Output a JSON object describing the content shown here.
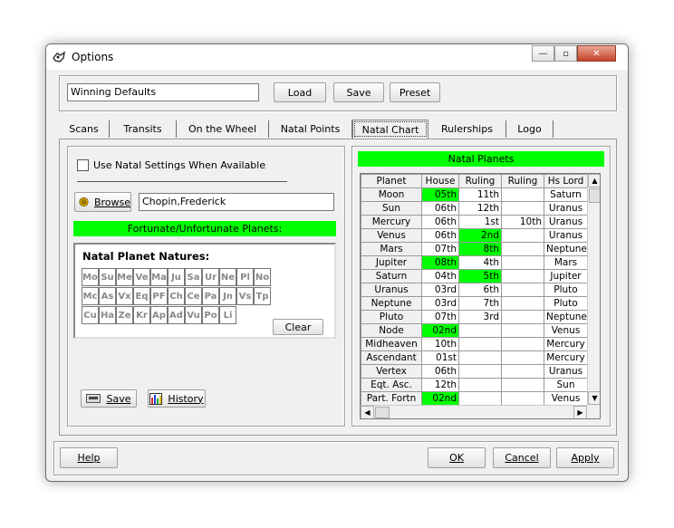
{
  "window": {
    "title": "Options",
    "minimize": "—",
    "restore": "▫",
    "close": "✕"
  },
  "preset": {
    "name_value": "Winning Defaults",
    "load_label": "Load",
    "save_label": "Save",
    "preset_label": "Preset"
  },
  "tabs": [
    {
      "label": "Scans"
    },
    {
      "label": "Transits"
    },
    {
      "label": "On the Wheel"
    },
    {
      "label": "Natal Points"
    },
    {
      "label": "Natal Chart"
    },
    {
      "label": "Rulerships"
    },
    {
      "label": "Logo"
    }
  ],
  "left": {
    "checkbox_label": "Use Natal Settings When Available",
    "browse_label": "Browse",
    "chart_name": "Chopin,Frederick",
    "fortunate_bar": "Fortunate/Unfortunate Planets:",
    "natures_title": "Natal Planet Natures:",
    "planets_row1": [
      "Mo",
      "Su",
      "Me",
      "Ve",
      "Ma",
      "Ju",
      "Sa",
      "Ur",
      "Ne",
      "Pl",
      "No"
    ],
    "planets_row2": [
      "Mc",
      "As",
      "Vx",
      "Eq",
      "PF",
      "Ch",
      "Ce",
      "Pa",
      "Jn",
      "Vs",
      "Tp"
    ],
    "planets_row3": [
      "Cu",
      "Ha",
      "Ze",
      "Kr",
      "Ap",
      "Ad",
      "Vu",
      "Po",
      "Li"
    ],
    "clear_label": "Clear",
    "save_label": "Save",
    "history_label": "History"
  },
  "natal": {
    "header": "Natal Planets",
    "columns": [
      "Planet",
      "House",
      "Ruling",
      "Ruling",
      "Hs Lord"
    ],
    "rows": [
      {
        "planet": "Moon",
        "house": "05th",
        "r1": "11th",
        "r2": "",
        "lord": "Saturn",
        "hl": true,
        "r1hl": false
      },
      {
        "planet": "Sun",
        "house": "06th",
        "r1": "12th",
        "r2": "",
        "lord": "Uranus",
        "hl": false,
        "r1hl": false
      },
      {
        "planet": "Mercury",
        "house": "06th",
        "r1": "1st",
        "r2": "10th",
        "lord": "Uranus",
        "hl": false,
        "r1hl": false
      },
      {
        "planet": "Venus",
        "house": "06th",
        "r1": "2nd",
        "r2": "",
        "lord": "Uranus",
        "hl": false,
        "r1hl": true
      },
      {
        "planet": "Mars",
        "house": "07th",
        "r1": "8th",
        "r2": "",
        "lord": "Neptune",
        "hl": false,
        "r1hl": true
      },
      {
        "planet": "Jupiter",
        "house": "08th",
        "r1": "4th",
        "r2": "",
        "lord": "Mars",
        "hl": true,
        "r1hl": false
      },
      {
        "planet": "Saturn",
        "house": "04th",
        "r1": "5th",
        "r2": "",
        "lord": "Jupiter",
        "hl": false,
        "r1hl": true
      },
      {
        "planet": "Uranus",
        "house": "03rd",
        "r1": "6th",
        "r2": "",
        "lord": "Pluto",
        "hl": false,
        "r1hl": false
      },
      {
        "planet": "Neptune",
        "house": "03rd",
        "r1": "7th",
        "r2": "",
        "lord": "Pluto",
        "hl": false,
        "r1hl": false
      },
      {
        "planet": "Pluto",
        "house": "07th",
        "r1": "3rd",
        "r2": "",
        "lord": "Neptune",
        "hl": false,
        "r1hl": false
      },
      {
        "planet": "Node",
        "house": "02nd",
        "r1": "",
        "r2": "",
        "lord": "Venus",
        "hl": true,
        "r1hl": false
      },
      {
        "planet": "Midheaven",
        "house": "10th",
        "r1": "",
        "r2": "",
        "lord": "Mercury",
        "hl": false,
        "r1hl": false
      },
      {
        "planet": "Ascendant",
        "house": "01st",
        "r1": "",
        "r2": "",
        "lord": "Mercury",
        "hl": false,
        "r1hl": false
      },
      {
        "planet": "Vertex",
        "house": "06th",
        "r1": "",
        "r2": "",
        "lord": "Uranus",
        "hl": false,
        "r1hl": false
      },
      {
        "planet": "Eqt. Asc.",
        "house": "12th",
        "r1": "",
        "r2": "",
        "lord": "Sun",
        "hl": false,
        "r1hl": false
      },
      {
        "planet": "Part. Fortn",
        "house": "02nd",
        "r1": "",
        "r2": "",
        "lord": "Venus",
        "hl": true,
        "r1hl": false
      }
    ]
  },
  "footer": {
    "help_label": "Help",
    "ok_label": "OK",
    "cancel_label": "Cancel",
    "apply_label": "Apply"
  },
  "colors": {
    "highlight": "#00ff00",
    "face": "#f0f0f0"
  }
}
